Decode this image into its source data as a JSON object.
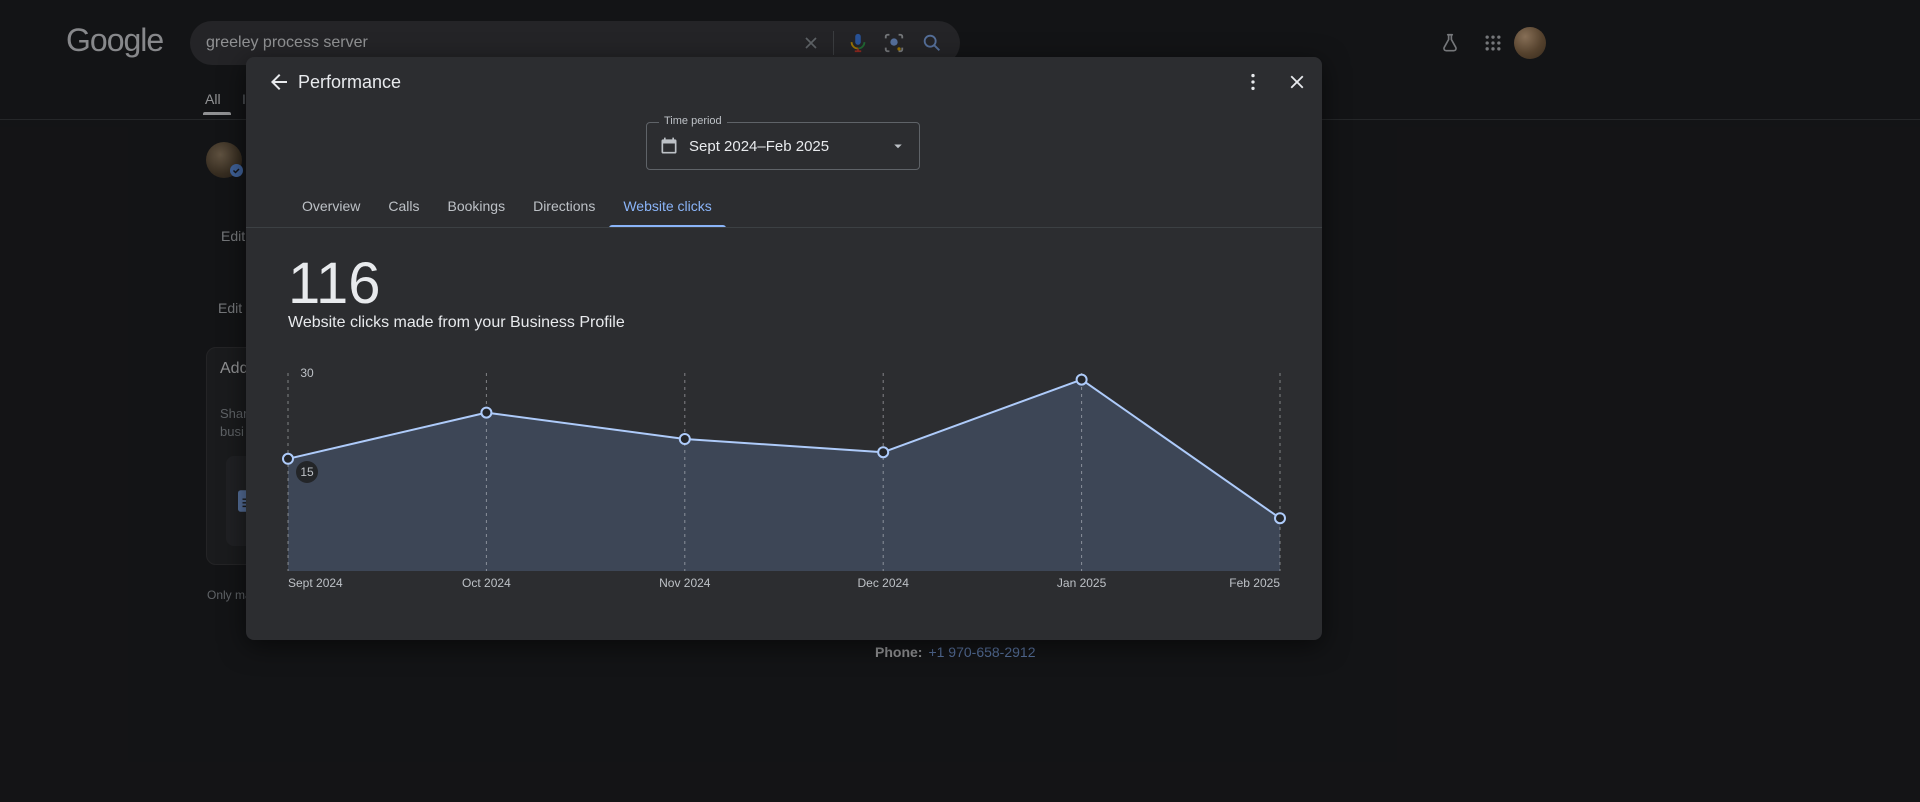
{
  "topbar": {
    "logo_text": "Google",
    "search_query": "greeley process server"
  },
  "background_page": {
    "tabs": [
      {
        "label": "All"
      },
      {
        "label": "Images"
      }
    ],
    "profile_snippets": {
      "edit_1": "Edit",
      "edit_2": "Edit s",
      "card_title": "Add",
      "card_line_1": "Shar",
      "card_line_2": "busi",
      "footnote": "Only ma"
    },
    "contact": {
      "phone_label": "Phone:",
      "phone_value": "+1 970-658-2912"
    }
  },
  "modal": {
    "title": "Performance",
    "time_period": {
      "label": "Time period",
      "value": "Sept 2024–Feb 2025"
    },
    "tabs": [
      {
        "label": "Overview",
        "active": false
      },
      {
        "label": "Calls",
        "active": false
      },
      {
        "label": "Bookings",
        "active": false
      },
      {
        "label": "Directions",
        "active": false
      },
      {
        "label": "Website clicks",
        "active": true
      }
    ],
    "metric_value": "116",
    "metric_description": "Website clicks made from your Business Profile"
  },
  "chart_data": {
    "type": "area",
    "title": "",
    "x": [
      "Sept 2024",
      "Oct 2024",
      "Nov 2024",
      "Dec 2024",
      "Jan 2025",
      "Feb 2025"
    ],
    "series": [
      {
        "name": "Website clicks",
        "values": [
          17,
          24,
          20,
          18,
          29,
          8
        ]
      }
    ],
    "ylim": [
      0,
      30
    ],
    "yticks": [
      15,
      30
    ],
    "grid": "vertical-dashed",
    "legend": "none",
    "colors": {
      "line": "#aecbfa",
      "area": "rgba(138,180,248,0.19)",
      "grid": "rgba(232,234,237,0.45)",
      "point_fill": "#24262a",
      "label": "#bdc1c6",
      "pill": "#232528"
    }
  },
  "colors": {
    "accent": "#8ab4f8",
    "modal_bg": "#2c2d30",
    "page_bg": "#202124"
  }
}
